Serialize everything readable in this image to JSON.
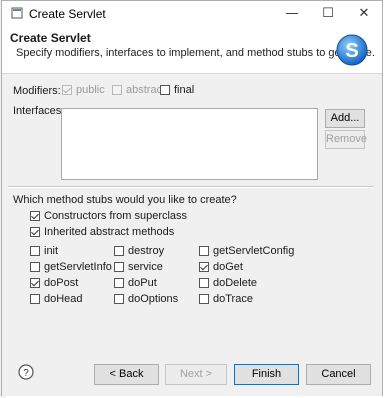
{
  "window": {
    "title": "Create Servlet",
    "minimize_glyph": "—",
    "maximize_glyph": "☐",
    "close_glyph": "✕"
  },
  "header": {
    "title": "Create Servlet",
    "description": "Specify modifiers, interfaces to implement, and method stubs to generate.",
    "logo_letter": "S"
  },
  "modifiers": {
    "label": "Modifiers:",
    "public_label": "public",
    "public_checked": true,
    "abstract_label": "abstract",
    "abstract_checked": false,
    "final_label": "final",
    "final_checked": false
  },
  "interfaces": {
    "label": "Interfaces:",
    "add_label": "Add...",
    "remove_label": "Remove"
  },
  "stubs": {
    "question": "Which method stubs would you like to create?",
    "constructors_label": "Constructors from superclass",
    "constructors_checked": true,
    "inherited_label": "Inherited abstract methods",
    "inherited_checked": true,
    "methods": [
      {
        "label": "init",
        "checked": false
      },
      {
        "label": "destroy",
        "checked": false
      },
      {
        "label": "getServletConfig",
        "checked": false
      },
      {
        "label": "getServletInfo",
        "checked": false
      },
      {
        "label": "service",
        "checked": false
      },
      {
        "label": "doGet",
        "checked": true
      },
      {
        "label": "doPost",
        "checked": true
      },
      {
        "label": "doPut",
        "checked": false
      },
      {
        "label": "doDelete",
        "checked": false
      },
      {
        "label": "doHead",
        "checked": false
      },
      {
        "label": "doOptions",
        "checked": false
      },
      {
        "label": "doTrace",
        "checked": false
      }
    ]
  },
  "footer": {
    "help_glyph": "?",
    "back_label": "< Back",
    "next_label": "Next >",
    "finish_label": "Finish",
    "cancel_label": "Cancel"
  },
  "colors": {
    "accent": "#0078d7",
    "logo_blue": "#1e88d8"
  }
}
